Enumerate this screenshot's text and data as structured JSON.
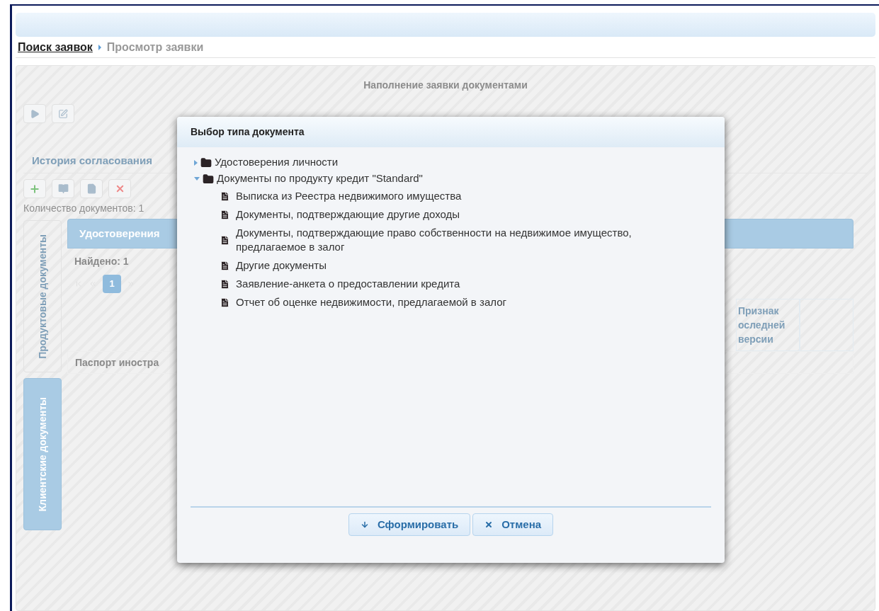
{
  "breadcrumb": [
    {
      "label": "Поиск заявок",
      "kind": "link"
    },
    {
      "label": "Просмотр заявки",
      "kind": "current"
    }
  ],
  "panel": {
    "title": "Наполнение заявки документами"
  },
  "history_tab": {
    "label": "История согласования"
  },
  "documents": {
    "count_label": "Количество документов: 1",
    "side_tabs": [
      {
        "label": "Продуктовые документы",
        "selected": false
      },
      {
        "label": "Клиентские документы",
        "selected": true
      }
    ],
    "section_tab": "Удостоверения",
    "found": "Найдено: 1",
    "pager": [
      {
        "label": "1",
        "selected": true
      }
    ],
    "header_cell": "Признак оследней версии",
    "row_cell": "Паспорт иностра"
  },
  "dialog": {
    "title": "Выбор типа документа",
    "tree": [
      {
        "label": "Удостоверения личности",
        "kind": "folder",
        "expanded": false
      },
      {
        "label": "Документы по продукту кредит \"Standard\"",
        "kind": "folder",
        "expanded": true,
        "children": [
          {
            "label": "Выписка из Реестра недвижимого имущества",
            "kind": "document"
          },
          {
            "label": "Документы, подтверждающие другие доходы",
            "kind": "document"
          },
          {
            "label": "Документы, подтверждающие право собственности на недвижимое имущество, предлагаемое в залог",
            "kind": "document"
          },
          {
            "label": "Другие документы",
            "kind": "document"
          },
          {
            "label": "Заявление-анкета о предоставлении кредита",
            "kind": "document"
          },
          {
            "label": "Отчет об оценке недвижимости, предлагаемой в залог",
            "kind": "document"
          }
        ]
      }
    ],
    "buttons": [
      {
        "label": "Сформировать",
        "kind": "submit"
      },
      {
        "label": "Отмена",
        "kind": "cancel"
      }
    ]
  }
}
